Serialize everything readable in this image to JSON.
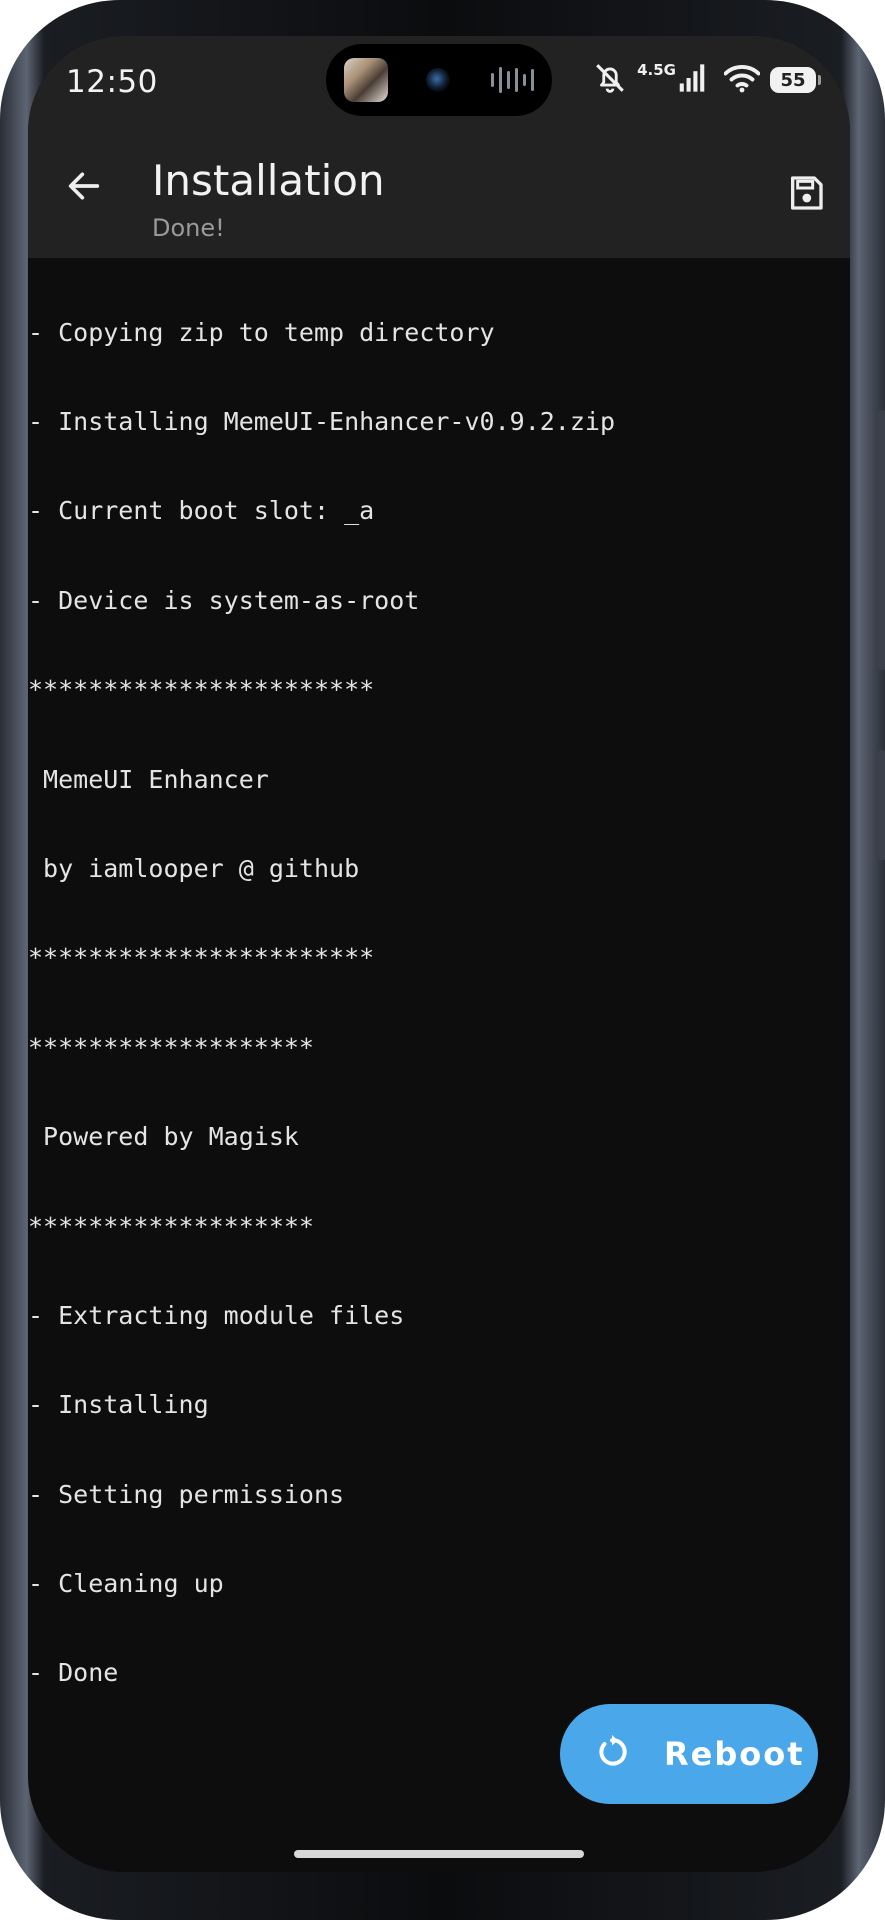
{
  "status_bar": {
    "time": "12:50",
    "network": "4.5G",
    "battery": "55"
  },
  "app_bar": {
    "title": "Installation",
    "subtitle": "Done!"
  },
  "log_lines": [
    "- Copying zip to temp directory",
    "- Installing MemeUI-Enhancer-v0.9.2.zip",
    "- Current boot slot: _a",
    "- Device is system-as-root",
    "***********************",
    " MemeUI Enhancer",
    " by iamlooper @ github",
    "***********************",
    "*******************",
    " Powered by Magisk",
    "*******************",
    "- Extracting module files",
    "- Installing",
    "- Setting permissions",
    "- Cleaning up",
    "- Done"
  ],
  "fab": {
    "label": "Reboot"
  },
  "icons": {
    "back": "arrow-back-icon",
    "save": "save-icon",
    "reboot": "restart-icon",
    "mute": "bell-off-icon",
    "signal": "cellular-signal-icon",
    "wifi": "wifi-icon",
    "battery": "battery-icon"
  },
  "colors": {
    "background": "#0d0d0d",
    "app_bar": "#222222",
    "accent": "#4aa8ea",
    "text": "#e4e4e4",
    "subtitle": "#9a9a9a"
  }
}
